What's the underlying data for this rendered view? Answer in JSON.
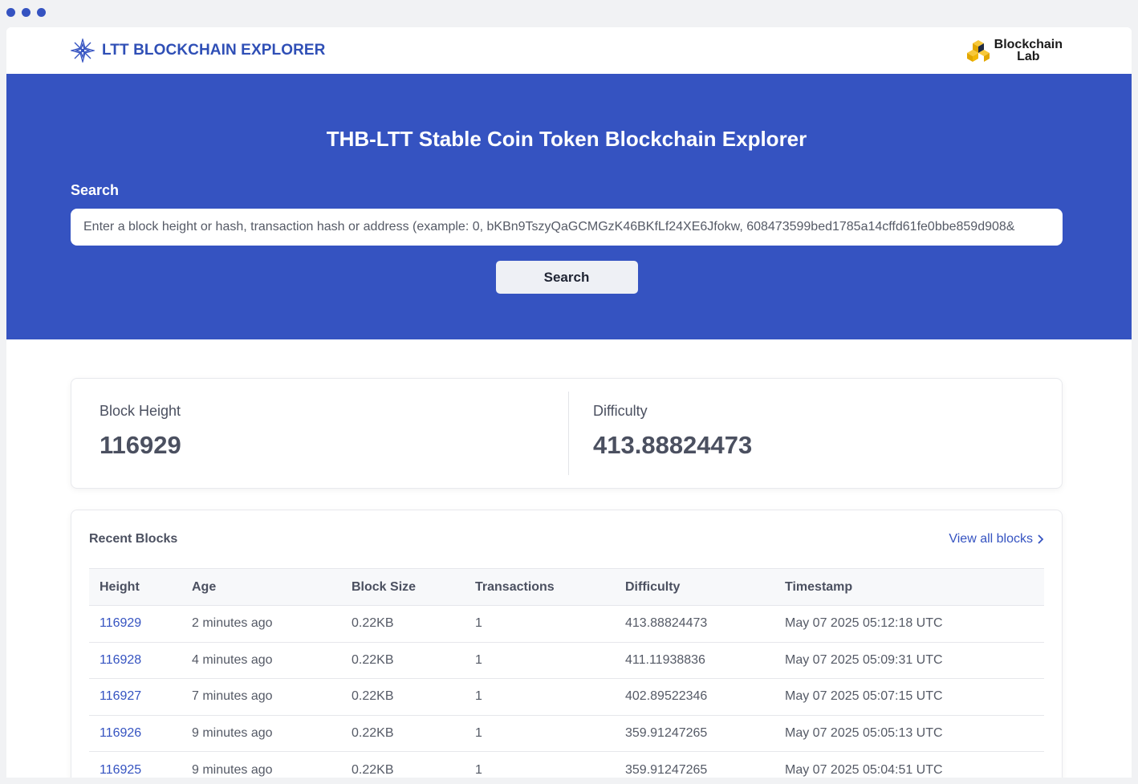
{
  "brand": {
    "title": "LTT BLOCKCHAIN EXPLORER"
  },
  "partner": {
    "line1": "Blockchain",
    "line2": "Lab"
  },
  "hero": {
    "title": "THB-LTT Stable Coin Token Blockchain Explorer",
    "search_label": "Search",
    "search_placeholder": "Enter a block height or hash, transaction hash or address (example: 0, bKBn9TszyQaGCMGzK46BKfLf24XE6Jfokw, 608473599bed1785a14cffd61fe0bbe859d908&",
    "search_button": "Search"
  },
  "stats": {
    "block_height_label": "Block Height",
    "block_height_value": "116929",
    "difficulty_label": "Difficulty",
    "difficulty_value": "413.88824473"
  },
  "recent_blocks": {
    "title": "Recent Blocks",
    "view_all": "View all blocks",
    "columns": [
      "Height",
      "Age",
      "Block Size",
      "Transactions",
      "Difficulty",
      "Timestamp"
    ],
    "rows": [
      {
        "height": "116929",
        "age": "2 minutes ago",
        "size": "0.22KB",
        "tx": "1",
        "difficulty": "413.88824473",
        "timestamp": "May 07 2025 05:12:18 UTC"
      },
      {
        "height": "116928",
        "age": "4 minutes ago",
        "size": "0.22KB",
        "tx": "1",
        "difficulty": "411.11938836",
        "timestamp": "May 07 2025 05:09:31 UTC"
      },
      {
        "height": "116927",
        "age": "7 minutes ago",
        "size": "0.22KB",
        "tx": "1",
        "difficulty": "402.89522346",
        "timestamp": "May 07 2025 05:07:15 UTC"
      },
      {
        "height": "116926",
        "age": "9 minutes ago",
        "size": "0.22KB",
        "tx": "1",
        "difficulty": "359.91247265",
        "timestamp": "May 07 2025 05:05:13 UTC"
      },
      {
        "height": "116925",
        "age": "9 minutes ago",
        "size": "0.22KB",
        "tx": "1",
        "difficulty": "359.91247265",
        "timestamp": "May 07 2025 05:04:51 UTC"
      }
    ]
  },
  "colors": {
    "accent": "#3553c1",
    "partner_yellow": "#f2b705"
  },
  "icons": {
    "brand": "compass-star-icon",
    "partner": "cubes-icon",
    "chevron": "chevron-right-icon"
  }
}
